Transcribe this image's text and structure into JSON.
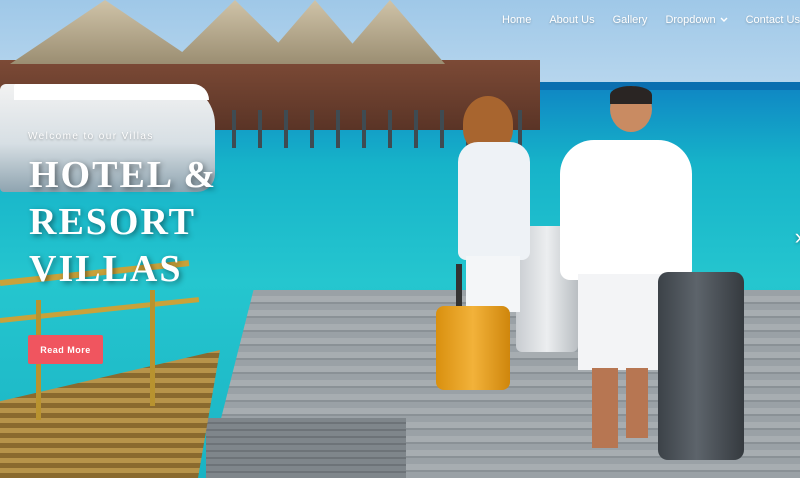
{
  "nav": {
    "items": [
      {
        "label": "Home"
      },
      {
        "label": "About Us"
      },
      {
        "label": "Gallery"
      },
      {
        "label": "Dropdown",
        "has_dropdown": true
      },
      {
        "label": "Contact Us"
      }
    ],
    "dropdown_icon": "chevron-down-icon"
  },
  "hero": {
    "welcome": "Welcome to our Villas",
    "headline_lines": [
      "HOTEL &",
      "RESORT",
      "VILLAS"
    ],
    "button_label": "Read More",
    "next_arrow": "›",
    "next_icon": "chevron-right-icon"
  },
  "colors": {
    "accent": "#f0555f",
    "sea": "#25c6cf",
    "text": "#ffffff"
  }
}
